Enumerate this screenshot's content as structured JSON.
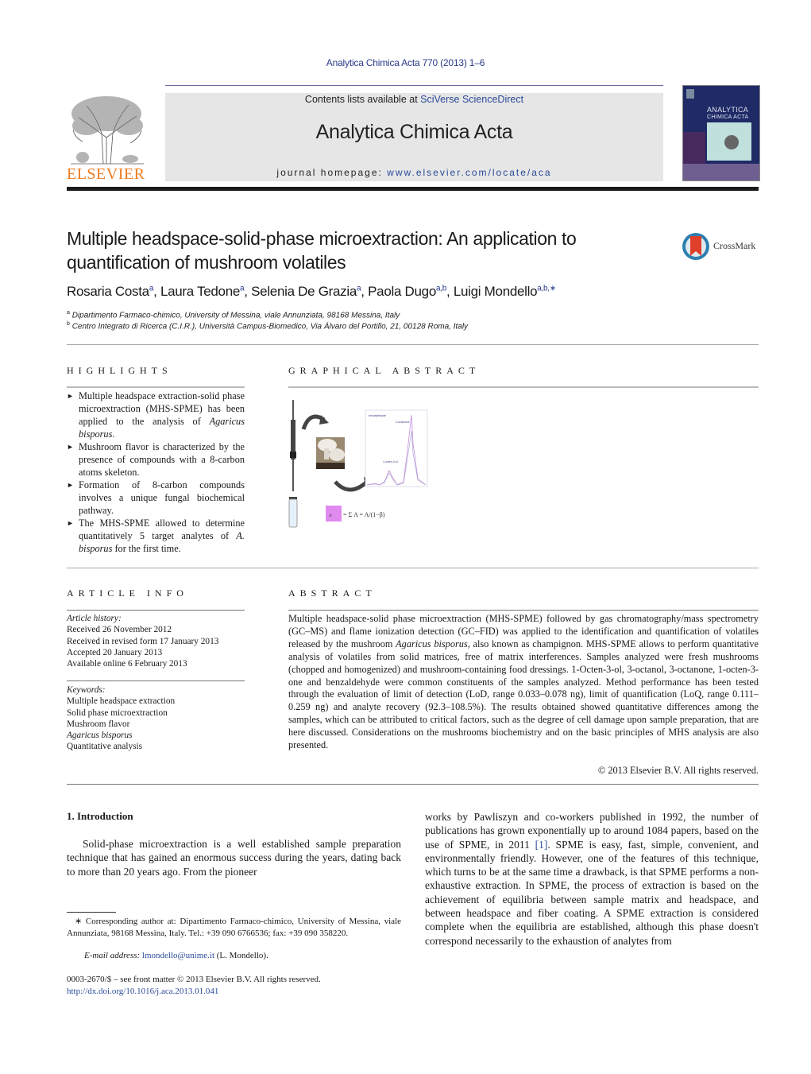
{
  "header": {
    "journal_reference": "Analytica Chimica Acta 770 (2013) 1–6",
    "contents_prefix": "Contents lists available at ",
    "contents_link": "SciVerse ScienceDirect",
    "journal_title": "Analytica Chimica Acta",
    "homepage_prefix": "journal homepage: ",
    "homepage_link": "www.elsevier.com/locate/aca",
    "publisher_logo_text": "ELSEVIER",
    "cover_title_line1": "ANALYTICA",
    "cover_title_line2": "CHIMICA ACTA",
    "crossmark_label": "CrossMark"
  },
  "article": {
    "title": "Multiple headspace-solid-phase microextraction: An application to quantification of mushroom volatiles",
    "authors": [
      {
        "name": "Rosaria Costa",
        "aff": "a"
      },
      {
        "name": "Laura Tedone",
        "aff": "a"
      },
      {
        "name": "Selenia De Grazia",
        "aff": "a"
      },
      {
        "name": "Paola Dugo",
        "aff": "a,b"
      },
      {
        "name": "Luigi Mondello",
        "aff": "a,b,∗"
      }
    ],
    "affiliations": [
      {
        "key": "a",
        "text": "Dipartimento Farmaco-chimico, University of Messina, viale Annunziata, 98168 Messina, Italy"
      },
      {
        "key": "b",
        "text": "Centro Integrato di Ricerca (C.I.R.), Università Campus-Biomedico, Via Álvaro del Portillo, 21, 00128 Roma, Italy"
      }
    ]
  },
  "highlights": {
    "heading": "HIGHLIGHTS",
    "items": [
      {
        "pre": "Multiple headspace extraction-solid phase microextraction (MHS-SPME) has been applied to the analysis of ",
        "italic": "Agaricus bisporus",
        "post": "."
      },
      {
        "pre": "Mushroom flavor is characterized by the presence of compounds with a 8-carbon atoms skeleton.",
        "italic": "",
        "post": ""
      },
      {
        "pre": "Formation of 8-carbon compounds involves a unique fungal biochemical pathway.",
        "italic": "",
        "post": ""
      },
      {
        "pre": "The MHS-SPME allowed to determine quantitatively 5 target analytes of ",
        "italic": "A. bisporus",
        "post": " for the first time."
      }
    ],
    "bullet_glyph": "►"
  },
  "graphical_abstract": {
    "heading": "GRAPHICAL ABSTRACT",
    "chromatogram_labels": [
      "1-octen-3-ol",
      "3-octanone",
      "benzaldehyde"
    ],
    "formula": "A_T = Σ A_i = A_1 / (1 − β)"
  },
  "article_info": {
    "heading": "ARTICLE INFO",
    "history_label": "Article history:",
    "history": [
      "Received 26 November 2012",
      "Received in revised form 17 January 2013",
      "Accepted 20 January 2013",
      "Available online 6 February 2013"
    ],
    "keywords_label": "Keywords:",
    "keywords": [
      {
        "text": "Multiple headspace extraction",
        "italic": false
      },
      {
        "text": "Solid phase microextraction",
        "italic": false
      },
      {
        "text": "Mushroom flavor",
        "italic": false
      },
      {
        "text": "Agaricus bisporus",
        "italic": true
      },
      {
        "text": "Quantitative analysis",
        "italic": false
      }
    ]
  },
  "abstract": {
    "heading": "ABSTRACT",
    "text_pre": "Multiple headspace-solid phase microextraction (MHS-SPME) followed by gas chromatography/mass spectrometry (GC–MS) and flame ionization detection (GC–FID) was applied to the identification and quantification of volatiles released by the mushroom ",
    "text_italic": "Agaricus bisporus",
    "text_post": ", also known as champignon. MHS-SPME allows to perform quantitative analysis of volatiles from solid matrices, free of matrix interferences. Samples analyzed were fresh mushrooms (chopped and homogenized) and mushroom-containing food dressings. 1-Octen-3-ol, 3-octanol, 3-octanone, 1-octen-3-one and benzaldehyde were common constituents of the samples analyzed. Method performance has been tested through the evaluation of limit of detection (LoD, range 0.033–0.078 ng), limit of quantification (LoQ, range 0.111–0.259 ng) and analyte recovery (92.3–108.5%). The results obtained showed quantitative differences among the samples, which can be attributed to critical factors, such as the degree of cell damage upon sample preparation, that are here discussed. Considerations on the mushrooms biochemistry and on the basic principles of MHS analysis are also presented.",
    "copyright": "© 2013 Elsevier B.V. All rights reserved."
  },
  "introduction": {
    "heading": "1.  Introduction",
    "left_text": "Solid-phase microextraction is a well established sample preparation technique that has gained an enormous success during the years, dating back to more than 20 years ago. From the pioneer",
    "right_pre": "works by Pawliszyn and co-workers published in 1992, the number of publications has grown exponentially up to around 1084 papers, based on the use of SPME, in 2011 ",
    "right_ref": "[1]",
    "right_post": ". SPME is easy, fast, simple, convenient, and environmentally friendly. However, one of the features of this technique, which turns to be at the same time a drawback, is that SPME performs a non-exhaustive extraction. In SPME, the process of extraction is based on the achievement of equilibria between sample matrix and headspace, and between headspace and fiber coating. A SPME extraction is considered complete when the equilibria are established, although this phase doesn't correspond necessarily to the exhaustion of analytes from"
  },
  "footnotes": {
    "corresponding": "∗ Corresponding author at: Dipartimento Farmaco-chimico, University of Messina, viale Annunziata, 98168 Messina, Italy. Tel.: +39 090 6766536; fax: +39 090 358220.",
    "email_label": "E-mail address: ",
    "email": "lmondello@unime.it",
    "email_suffix": " (L. Mondello).",
    "front_matter": "0003-2670/$ – see front matter © 2013 Elsevier B.V. All rights reserved.",
    "doi": "http://dx.doi.org/10.1016/j.aca.2013.01.041"
  }
}
